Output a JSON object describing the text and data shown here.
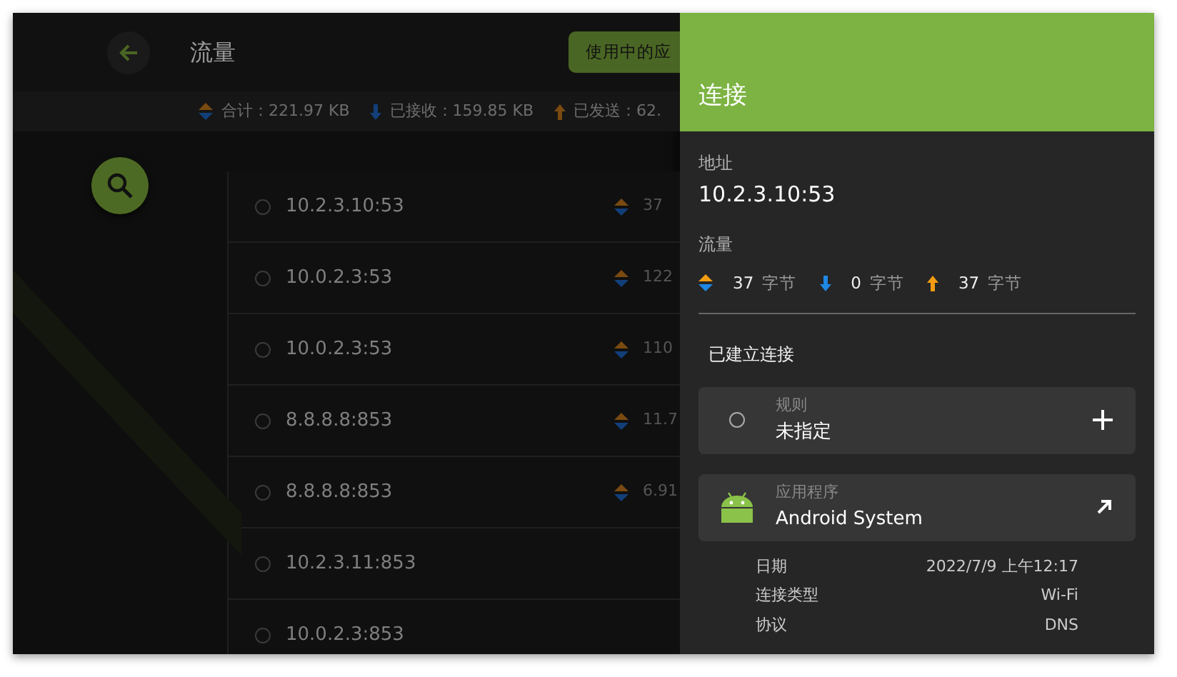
{
  "app_bar": {
    "title": "流量",
    "button": "使用中的应"
  },
  "summary": [
    {
      "kind": "total",
      "label": "合计：221.97 KB"
    },
    {
      "kind": "received",
      "label": "已接收：159.85 KB"
    },
    {
      "kind": "sent",
      "label": "已发送：62."
    }
  ],
  "connections": [
    {
      "address": "10.2.3.10:53",
      "traffic": "37"
    },
    {
      "address": "10.0.2.3:53",
      "traffic": "122"
    },
    {
      "address": "10.0.2.3:53",
      "traffic": "110"
    },
    {
      "address": "8.8.8.8:853",
      "traffic": "11.7"
    },
    {
      "address": "8.8.8.8:853",
      "traffic": "6.91"
    },
    {
      "address": "10.2.3.11:853"
    },
    {
      "address": "10.0.2.3:853"
    }
  ],
  "detail": {
    "title": "连接",
    "address_label": "地址",
    "address": "10.2.3.10:53",
    "traffic_label": "流量",
    "traffic": [
      {
        "kind": "total",
        "amount": "37",
        "unit": "字节"
      },
      {
        "kind": "received",
        "amount": "0",
        "unit": "字节"
      },
      {
        "kind": "sent",
        "amount": "37",
        "unit": "字节"
      }
    ],
    "status": "已建立连接",
    "rule": {
      "label": "规则",
      "value": "未指定"
    },
    "app": {
      "label": "应用程序",
      "value": "Android System"
    },
    "info": [
      {
        "label": "日期",
        "value": "2022/7/9 上午12:17"
      },
      {
        "label": "连接类型",
        "value": "Wi-Fi"
      },
      {
        "label": "协议",
        "value": "DNS"
      }
    ]
  }
}
